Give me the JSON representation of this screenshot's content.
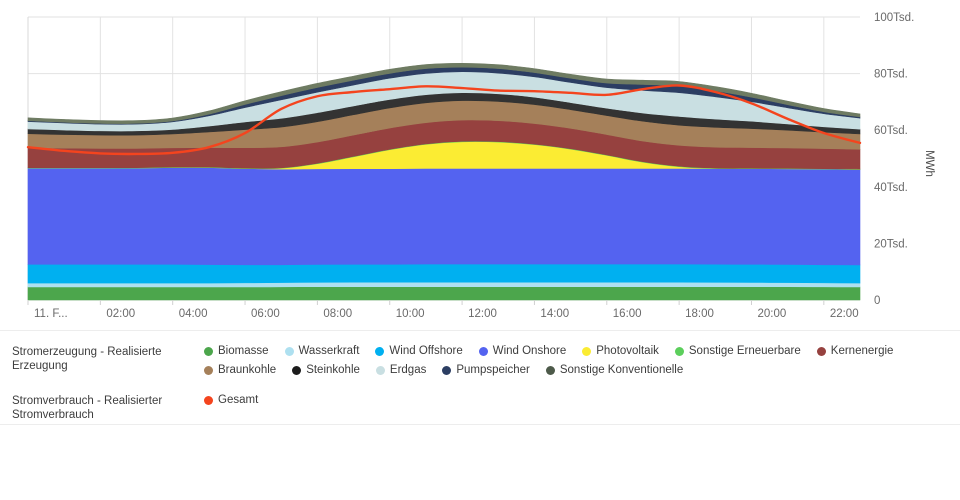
{
  "chart_data": {
    "type": "area",
    "stacked": true,
    "title": "",
    "xlabel": "",
    "ylabel": "MWh",
    "ylim": [
      0,
      100000
    ],
    "yticks": [
      0,
      20000,
      40000,
      60000,
      80000,
      100000
    ],
    "ytick_labels": [
      "0",
      "20Tsd.",
      "40Tsd.",
      "60Tsd.",
      "80Tsd.",
      "100Tsd."
    ],
    "grid": true,
    "legend_position": "bottom",
    "x": [
      0,
      1,
      2,
      3,
      4,
      5,
      6,
      7,
      8,
      9,
      10,
      11,
      12,
      13,
      14,
      15,
      16,
      17,
      18,
      19,
      20,
      21,
      22,
      23
    ],
    "xtick_labels": [
      "11. F...",
      "02:00",
      "04:00",
      "06:00",
      "08:00",
      "10:00",
      "12:00",
      "14:00",
      "16:00",
      "18:00",
      "20:00",
      "22:00"
    ],
    "xtick_positions": [
      0,
      2,
      4,
      6,
      8,
      10,
      12,
      14,
      16,
      18,
      20,
      22
    ],
    "series": [
      {
        "name": "Biomasse",
        "color": "#4CA64C",
        "values": [
          4600,
          4600,
          4600,
          4600,
          4600,
          4600,
          4600,
          4650,
          4700,
          4700,
          4700,
          4700,
          4700,
          4700,
          4700,
          4700,
          4700,
          4700,
          4700,
          4700,
          4700,
          4700,
          4650,
          4600
        ]
      },
      {
        "name": "Wasserkraft",
        "color": "#AEE0F0",
        "values": [
          1400,
          1400,
          1400,
          1400,
          1400,
          1400,
          1450,
          1500,
          1550,
          1600,
          1600,
          1600,
          1600,
          1600,
          1600,
          1600,
          1600,
          1600,
          1600,
          1550,
          1500,
          1450,
          1400,
          1400
        ]
      },
      {
        "name": "Wind Offshore",
        "color": "#00B0F0",
        "values": [
          6600,
          6600,
          6600,
          6600,
          6600,
          6500,
          6400,
          6300,
          6300,
          6300,
          6300,
          6400,
          6400,
          6400,
          6400,
          6400,
          6400,
          6400,
          6400,
          6400,
          6400,
          6400,
          6400,
          6400
        ]
      },
      {
        "name": "Wind Onshore",
        "color": "#5463F0",
        "values": [
          34000,
          34000,
          34000,
          34000,
          34200,
          34300,
          34000,
          33800,
          33800,
          33800,
          33800,
          33800,
          33800,
          33800,
          33800,
          33800,
          33800,
          33800,
          33800,
          33800,
          33800,
          33800,
          33800,
          33700
        ]
      },
      {
        "name": "Photovoltaik",
        "color": "#FBEC33",
        "values": [
          0,
          0,
          0,
          0,
          0,
          0,
          0,
          300,
          1800,
          4200,
          6700,
          8500,
          9400,
          9300,
          8400,
          6800,
          4600,
          2200,
          600,
          0,
          0,
          0,
          0,
          0
        ]
      },
      {
        "name": "Sonstige Erneuerbare",
        "color": "#5CCF5C",
        "values": [
          160,
          160,
          160,
          160,
          160,
          160,
          160,
          160,
          160,
          160,
          160,
          160,
          160,
          160,
          160,
          160,
          160,
          160,
          160,
          160,
          160,
          160,
          160,
          160
        ]
      },
      {
        "name": "Kernenergie",
        "color": "#96413F",
        "values": [
          7000,
          6900,
          6800,
          6800,
          6800,
          6900,
          7200,
          7400,
          7500,
          7500,
          7500,
          7500,
          7500,
          7400,
          7300,
          7200,
          7200,
          7300,
          7400,
          7400,
          7300,
          7200,
          7100,
          7000
        ]
      },
      {
        "name": "Braunkohle",
        "color": "#A5805A",
        "values": [
          5000,
          4800,
          4700,
          4700,
          4900,
          5500,
          6400,
          7000,
          7200,
          7200,
          7100,
          7000,
          6900,
          6800,
          6700,
          6600,
          6700,
          7000,
          7100,
          7000,
          6700,
          6300,
          5800,
          5400
        ]
      },
      {
        "name": "Steinkohle",
        "color": "#333333",
        "values": [
          1700,
          1600,
          1500,
          1500,
          1600,
          2100,
          2700,
          3100,
          3200,
          3100,
          3000,
          2900,
          2800,
          2700,
          2600,
          2500,
          2600,
          2900,
          3100,
          2900,
          2600,
          2200,
          1900,
          1700
        ]
      },
      {
        "name": "Erdgas",
        "color": "#C9DFE2",
        "values": [
          2600,
          2500,
          2400,
          2400,
          2700,
          3600,
          5100,
          6500,
          7200,
          7400,
          7500,
          7500,
          7400,
          7300,
          7200,
          7100,
          7300,
          8000,
          8400,
          7900,
          6900,
          5700,
          4600,
          3900
        ]
      },
      {
        "name": "Pumpspeicher",
        "color": "#2C3E63",
        "values": [
          300,
          250,
          250,
          250,
          300,
          600,
          1100,
          1500,
          1700,
          1700,
          1700,
          1700,
          1600,
          1600,
          1500,
          1500,
          1600,
          2100,
          2400,
          2100,
          1600,
          1100,
          700,
          450
        ]
      },
      {
        "name": "Sonstige Konventionelle",
        "color": "#6E7B62",
        "values": [
          1000,
          1000,
          1000,
          1000,
          1050,
          1150,
          1300,
          1400,
          1450,
          1450,
          1450,
          1450,
          1400,
          1400,
          1400,
          1400,
          1400,
          1500,
          1550,
          1500,
          1400,
          1250,
          1150,
          1050
        ]
      }
    ],
    "overlay_series": [
      {
        "name": "Gesamt",
        "color": "#F4441E",
        "type": "line",
        "values": [
          54000,
          52700,
          51800,
          51600,
          52000,
          54000,
          59000,
          67500,
          72000,
          73500,
          74500,
          75500,
          74900,
          74000,
          73800,
          73200,
          72500,
          74500,
          75800,
          73500,
          69500,
          64000,
          59000,
          55500
        ]
      }
    ]
  },
  "legend": {
    "generation": {
      "title": "Stromerzeugung - Realisierte Erzeugung",
      "items": [
        {
          "label": "Biomasse",
          "color": "#4CA64C"
        },
        {
          "label": "Wasserkraft",
          "color": "#AEE0F0"
        },
        {
          "label": "Wind Offshore",
          "color": "#00B0F0"
        },
        {
          "label": "Wind Onshore",
          "color": "#5463F0"
        },
        {
          "label": "Photovoltaik",
          "color": "#FBEC33"
        },
        {
          "label": "Sonstige Erneuerbare",
          "color": "#5CCF5C"
        },
        {
          "label": "Kernenergie",
          "color": "#96413F"
        },
        {
          "label": "Braunkohle",
          "color": "#A5805A"
        },
        {
          "label": "Steinkohle",
          "color": "#1C1C1C"
        },
        {
          "label": "Erdgas",
          "color": "#C9DFE2"
        },
        {
          "label": "Pumpspeicher",
          "color": "#2C3E63"
        },
        {
          "label": "Sonstige Konventionelle",
          "color": "#4D5A4A"
        }
      ]
    },
    "consumption": {
      "title": "Stromverbrauch - Realisierter Stromverbrauch",
      "items": [
        {
          "label": "Gesamt",
          "color": "#F4441E"
        }
      ]
    }
  }
}
